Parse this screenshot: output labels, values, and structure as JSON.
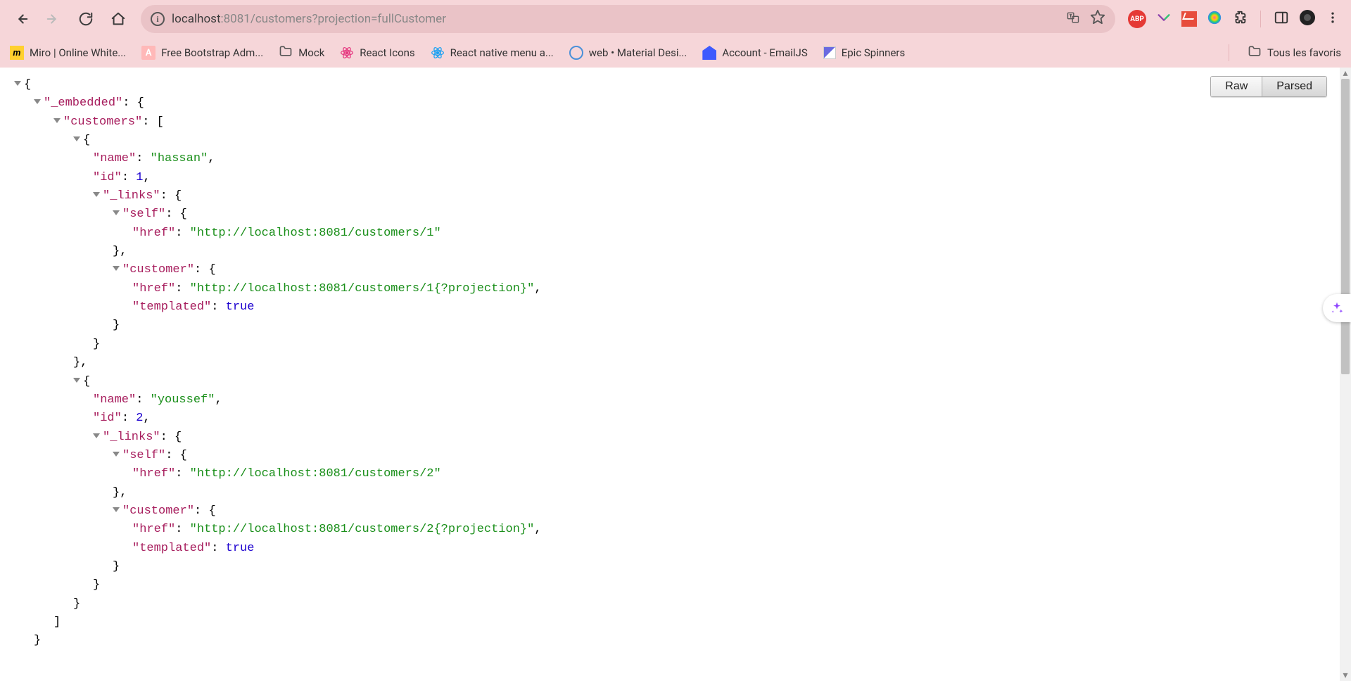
{
  "address": {
    "host": "localhost",
    "port": ":8081",
    "path": "/customers?projection=fullCustomer"
  },
  "bookmarks": [
    {
      "label": "Miro | Online White...",
      "icon": "miro"
    },
    {
      "label": "Free Bootstrap Adm...",
      "icon": "a-pink"
    },
    {
      "label": "Mock",
      "icon": "folder"
    },
    {
      "label": "React Icons",
      "icon": "atom-pink"
    },
    {
      "label": "React native menu a...",
      "icon": "atom-blue"
    },
    {
      "label": "web • Material Desi...",
      "icon": "smiley"
    },
    {
      "label": "Account - EmailJS",
      "icon": "emailjs"
    },
    {
      "label": "Epic Spinners",
      "icon": "spinner"
    }
  ],
  "all_bookmarks_label": "Tous les favoris",
  "viewer": {
    "raw_label": "Raw",
    "parsed_label": "Parsed"
  },
  "json_body": {
    "_embedded": {
      "customers": [
        {
          "name": "hassan",
          "id": 1,
          "_links": {
            "self": {
              "href": "http://localhost:8081/customers/1"
            },
            "customer": {
              "href": "http://localhost:8081/customers/1{?projection}",
              "templated": true
            }
          }
        },
        {
          "name": "youssef",
          "id": 2,
          "_links": {
            "self": {
              "href": "http://localhost:8081/customers/2"
            },
            "customer": {
              "href": "http://localhost:8081/customers/2{?projection}",
              "templated": true
            }
          }
        }
      ]
    }
  }
}
